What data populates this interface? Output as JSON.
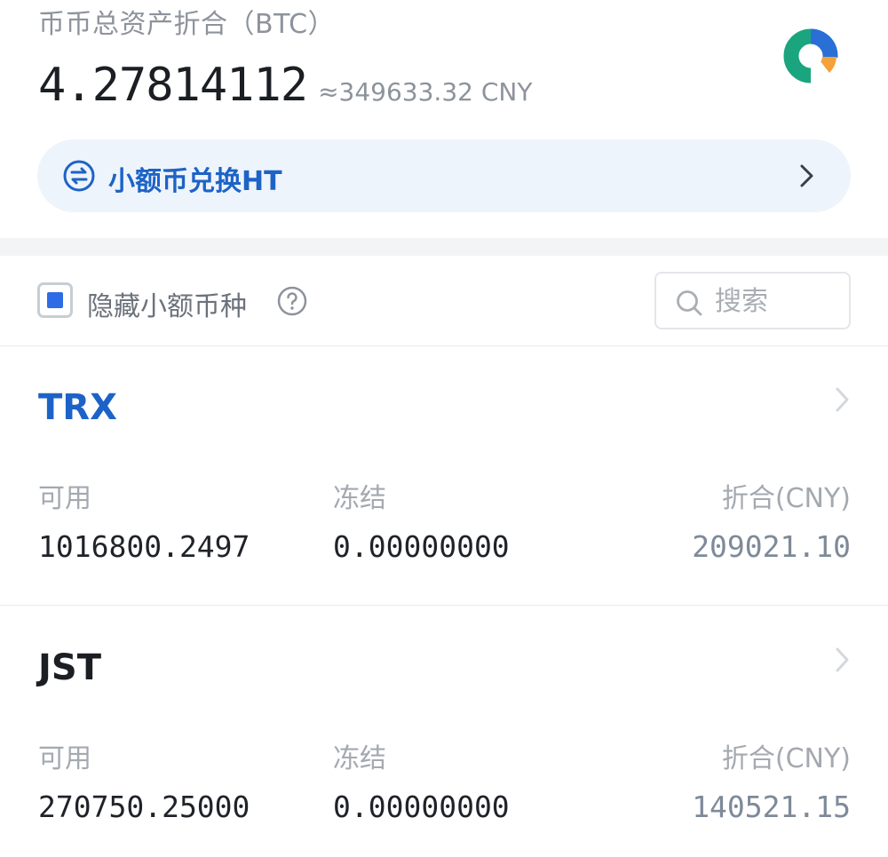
{
  "summary": {
    "total_label": "币币总资产折合（BTC）",
    "total_btc": "4.27814112",
    "total_cny": "≈349633.32 CNY"
  },
  "convert": {
    "label": "小额币兑换HT"
  },
  "filter": {
    "hide_small_label": "隐藏小额币种",
    "hide_small_checked": true,
    "search_placeholder": "搜索",
    "search_value": ""
  },
  "columns": {
    "available": "可用",
    "frozen": "冻结",
    "equivalent": "折合(CNY)"
  },
  "coins": [
    {
      "name": "TRX",
      "available": "1016800.2497",
      "frozen": "0.00000000",
      "equivalent": "209021.10"
    },
    {
      "name": "JST",
      "available": "270750.25000",
      "frozen": "0.00000000",
      "equivalent": "140521.15"
    }
  ],
  "colors": {
    "accent_blue": "#1d63c7",
    "trx_name": "#1d63c7",
    "jst_name": "#1b1f24",
    "pie_blue": "#2a6fd6",
    "pie_green": "#1aa57f",
    "pie_orange": "#f4a13a"
  },
  "icons": {
    "pie": "pie-chart-icon",
    "convert": "swap-circle-icon",
    "chevron": "chevron-right-icon",
    "help": "question-circle-icon",
    "search": "search-icon"
  }
}
